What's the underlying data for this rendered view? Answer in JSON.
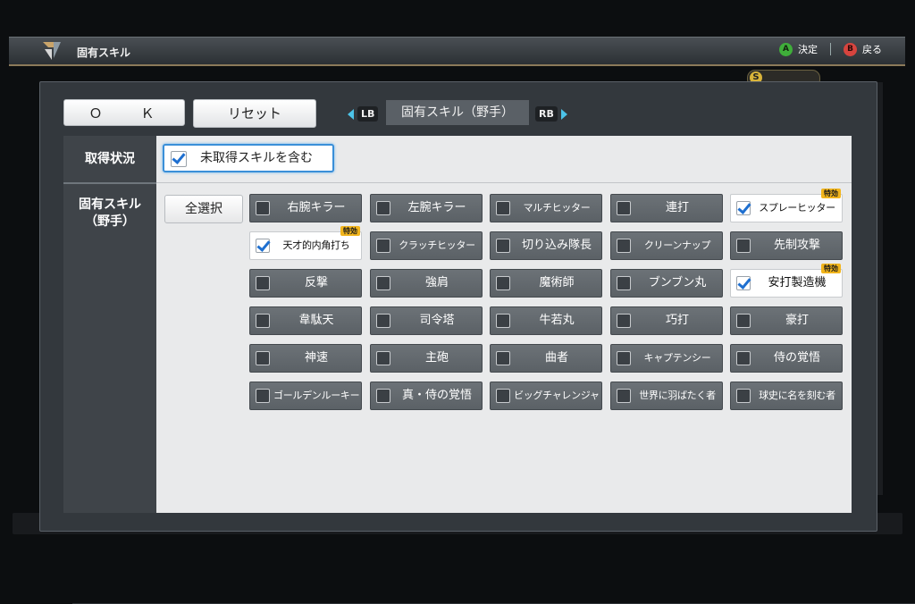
{
  "topbar": {
    "title": "固有スキル",
    "confirm_button": "A",
    "confirm_label": "決定",
    "back_button": "B",
    "back_label": "戻る"
  },
  "background_badge": {
    "letter": "S"
  },
  "panel": {
    "ok_label": "Ｏ　Ｋ",
    "reset_label": "リセット",
    "lb_label": "LB",
    "rb_label": "RB",
    "category_label": "固有スキル（野手）"
  },
  "filters": {
    "status_label": "取得状況",
    "include_unacquired_label": "未取得スキルを含む",
    "include_unacquired_checked": true,
    "skills_label_line1": "固有スキル",
    "skills_label_line2": "（野手）",
    "select_all_label": "全選択"
  },
  "skill_badge_label": "特効",
  "skills": [
    {
      "name": "右腕キラー",
      "checked": false,
      "special": false
    },
    {
      "name": "左腕キラー",
      "checked": false,
      "special": false
    },
    {
      "name": "マルチヒッター",
      "checked": false,
      "special": false
    },
    {
      "name": "連打",
      "checked": false,
      "special": false
    },
    {
      "name": "スプレーヒッター",
      "checked": true,
      "special": true
    },
    {
      "name": "天才的内角打ち",
      "checked": true,
      "special": true
    },
    {
      "name": "クラッチヒッター",
      "checked": false,
      "special": false
    },
    {
      "name": "切り込み隊長",
      "checked": false,
      "special": false
    },
    {
      "name": "クリーンナップ",
      "checked": false,
      "special": false
    },
    {
      "name": "先制攻撃",
      "checked": false,
      "special": false
    },
    {
      "name": "反撃",
      "checked": false,
      "special": false
    },
    {
      "name": "強肩",
      "checked": false,
      "special": false
    },
    {
      "name": "魔術師",
      "checked": false,
      "special": false
    },
    {
      "name": "ブンブン丸",
      "checked": false,
      "special": false
    },
    {
      "name": "安打製造機",
      "checked": true,
      "special": true
    },
    {
      "name": "韋駄天",
      "checked": false,
      "special": false
    },
    {
      "name": "司令塔",
      "checked": false,
      "special": false
    },
    {
      "name": "牛若丸",
      "checked": false,
      "special": false
    },
    {
      "name": "巧打",
      "checked": false,
      "special": false
    },
    {
      "name": "豪打",
      "checked": false,
      "special": false
    },
    {
      "name": "神速",
      "checked": false,
      "special": false
    },
    {
      "name": "主砲",
      "checked": false,
      "special": false
    },
    {
      "name": "曲者",
      "checked": false,
      "special": false
    },
    {
      "name": "キャプテンシー",
      "checked": false,
      "special": false
    },
    {
      "name": "侍の覚悟",
      "checked": false,
      "special": false
    },
    {
      "name": "ゴールデンルーキー",
      "checked": false,
      "special": false
    },
    {
      "name": "真・侍の覚悟",
      "checked": false,
      "special": false
    },
    {
      "name": "ビッグチャレンジャー",
      "checked": false,
      "special": false
    },
    {
      "name": "世界に羽ばたく者",
      "checked": false,
      "special": false
    },
    {
      "name": "球史に名を刻む者",
      "checked": false,
      "special": false
    }
  ]
}
